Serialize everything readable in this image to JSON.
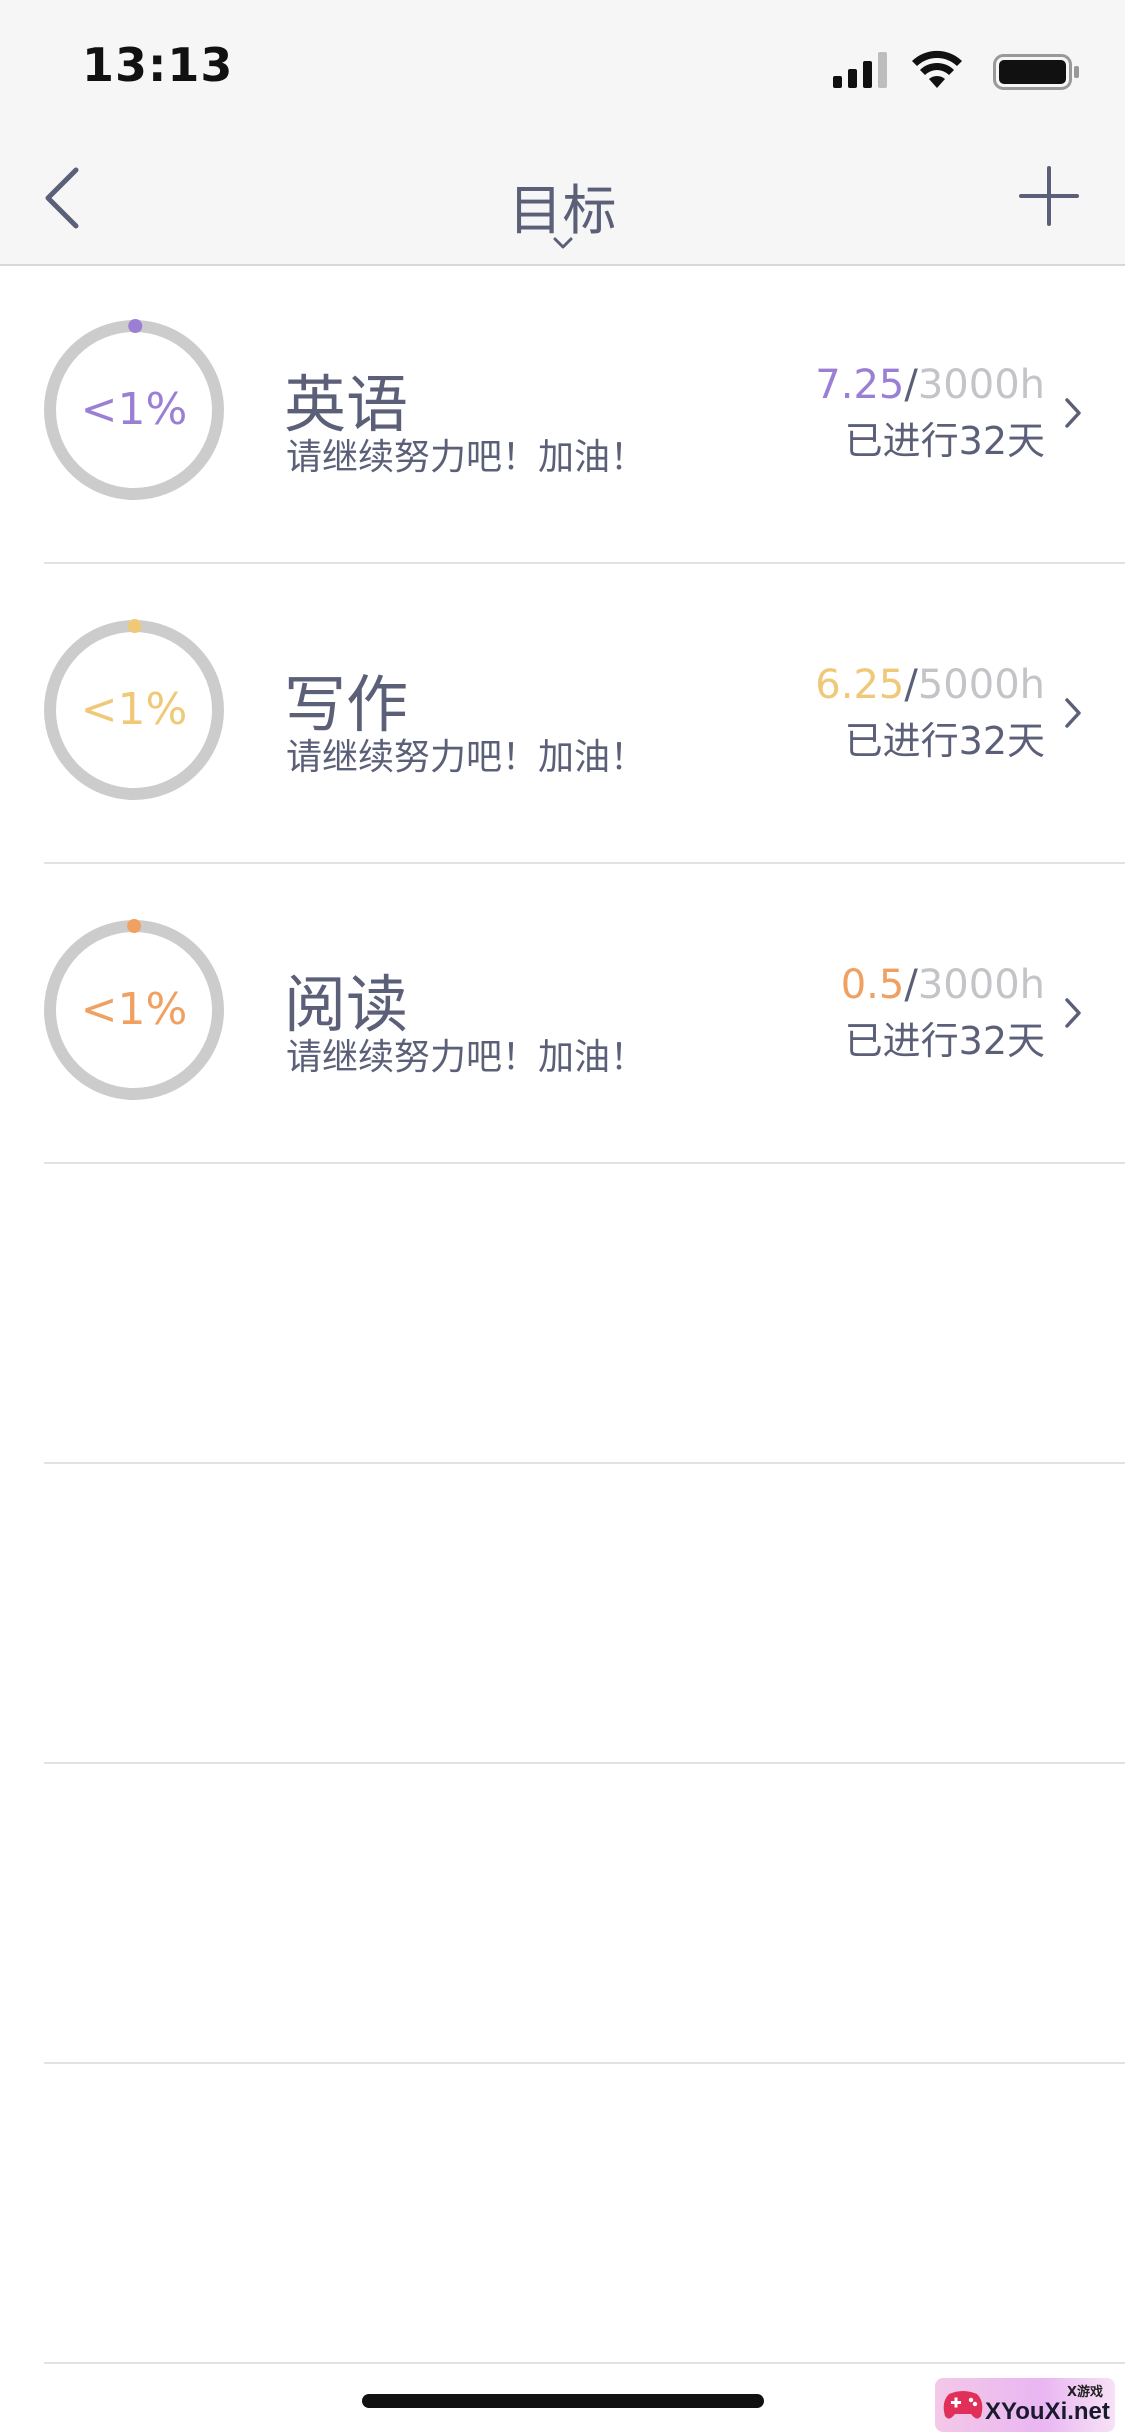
{
  "status_bar": {
    "time": "13:13"
  },
  "nav": {
    "title": "目标",
    "back_icon": "chevron-left-icon",
    "add_icon": "plus-icon"
  },
  "goals": [
    {
      "name": "英语",
      "subtitle": "请继续努力吧！加油！",
      "percent_label": "<1%",
      "hours_done": "7.25",
      "hours_sep": "/",
      "hours_target": "3000h",
      "days": "已进行32天",
      "progress": 0.0024,
      "color": "#9b7fd4"
    },
    {
      "name": "写作",
      "subtitle": "请继续努力吧！加油！",
      "percent_label": "<1%",
      "hours_done": "6.25",
      "hours_sep": "/",
      "hours_target": "5000h",
      "days": "已进行32天",
      "progress": 0.0013,
      "color": "#f0c978"
    },
    {
      "name": "阅读",
      "subtitle": "请继续努力吧！加油！",
      "percent_label": "<1%",
      "hours_done": "0.5",
      "hours_sep": "/",
      "hours_target": "3000h",
      "days": "已进行32天",
      "progress": 0.0002,
      "color": "#f0a060"
    }
  ],
  "colors": {
    "ring_track": "#cccccc",
    "text_primary": "#5b6078",
    "text_muted": "#c4c4c8"
  },
  "watermark": {
    "top": "X游戏",
    "text": "XYouXi.net"
  }
}
